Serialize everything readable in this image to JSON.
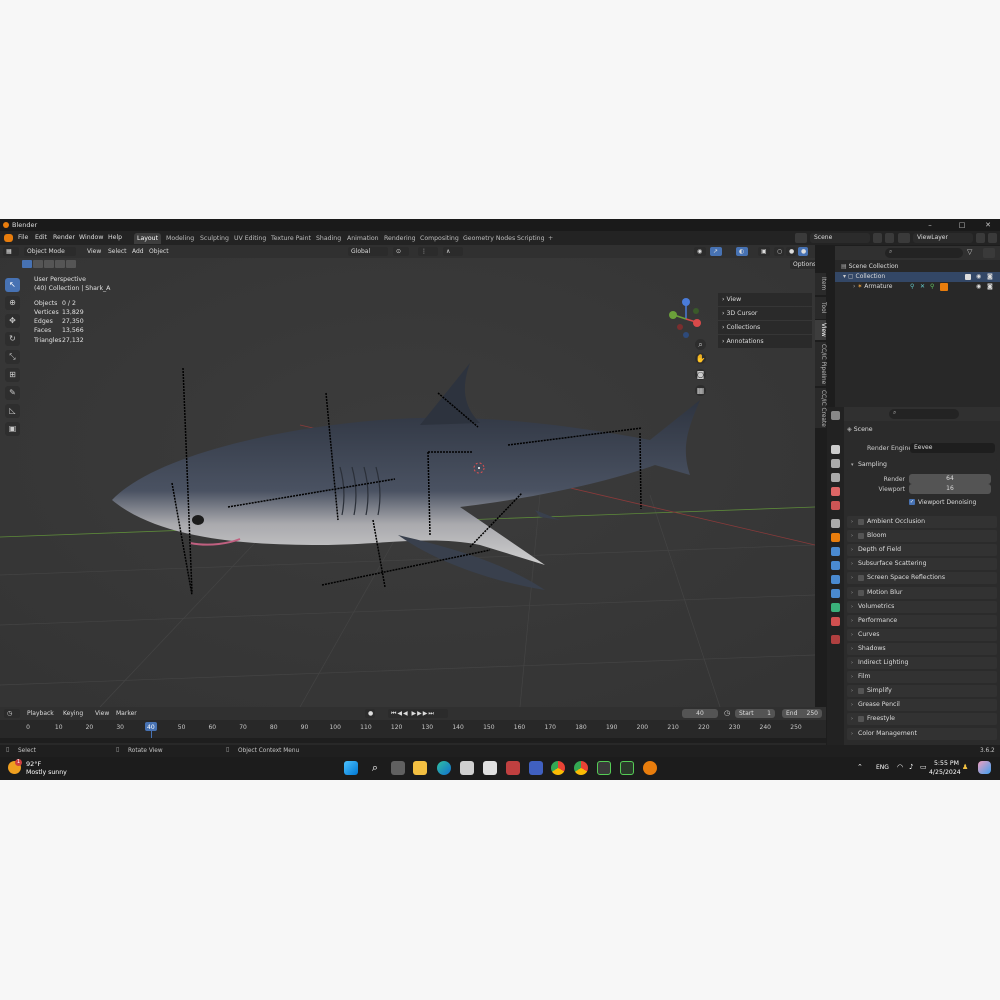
{
  "window": {
    "title": "Blender",
    "controls": [
      "–",
      "□",
      "✕"
    ]
  },
  "menu": {
    "items": [
      "File",
      "Edit",
      "Render",
      "Window",
      "Help"
    ]
  },
  "workspaces": {
    "tabs": [
      "Layout",
      "Modeling",
      "Sculpting",
      "UV Editing",
      "Texture Paint",
      "Shading",
      "Animation",
      "Rendering",
      "Compositing",
      "Geometry Nodes",
      "Scripting"
    ],
    "active": "Layout",
    "add": "+"
  },
  "scene_field": "Scene",
  "view_layer_field": "ViewLayer",
  "viewport": {
    "mode": "Object Mode",
    "header_menus": [
      "View",
      "Select",
      "Add",
      "Object"
    ],
    "orientation": "Global",
    "options": "Options",
    "info_line1": "User Perspective",
    "info_line2": "(40) Collection | Shark_A",
    "stats": [
      {
        "key": "Objects",
        "value": "0 / 2"
      },
      {
        "key": "Vertices",
        "value": "13,829"
      },
      {
        "key": "Edges",
        "value": "27,350"
      },
      {
        "key": "Faces",
        "value": "13,566"
      },
      {
        "key": "Triangles",
        "value": "27,132"
      }
    ],
    "side_items": [
      "View",
      "3D Cursor",
      "Collections",
      "Annotations"
    ],
    "side_tabs": [
      "Item",
      "Tool",
      "View",
      "CC/iC Pipeline",
      "CC/iC Create"
    ],
    "gizmo_labels": {
      "z": "Z",
      "y": "Y",
      "x": "X"
    }
  },
  "timeline": {
    "menus": [
      "Playback",
      "Keying",
      "View",
      "Marker"
    ],
    "current_frame": "40",
    "start_label": "Start",
    "start": "1",
    "end_label": "End",
    "end": "250",
    "ticks": [
      "0",
      "10",
      "20",
      "30",
      "40",
      "50",
      "60",
      "70",
      "80",
      "90",
      "100",
      "110",
      "120",
      "130",
      "140",
      "150",
      "160",
      "170",
      "180",
      "190",
      "200",
      "210",
      "220",
      "230",
      "240",
      "250"
    ],
    "playhead": 40
  },
  "statusbar": {
    "select": "Select",
    "rotate": "Rotate View",
    "context": "Object Context Menu",
    "version": "3.6.2"
  },
  "outliner": {
    "rows": [
      {
        "label": "Scene Collection",
        "indent": 0
      },
      {
        "label": "Collection",
        "indent": 1
      },
      {
        "label": "Armature",
        "indent": 2
      }
    ]
  },
  "properties": {
    "scene_label": "Scene",
    "render_engine_label": "Render Engine",
    "render_engine_value": "Eevee",
    "sampling": "Sampling",
    "render_label": "Render",
    "render_value": "64",
    "viewport_label": "Viewport",
    "viewport_value": "16",
    "denoise_label": "Viewport Denoising",
    "panels": [
      {
        "label": "Ambient Occlusion",
        "checkbox": true
      },
      {
        "label": "Bloom",
        "checkbox": true
      },
      {
        "label": "Depth of Field",
        "checkbox": false
      },
      {
        "label": "Subsurface Scattering",
        "checkbox": false
      },
      {
        "label": "Screen Space Reflections",
        "checkbox": true
      },
      {
        "label": "Motion Blur",
        "checkbox": true
      },
      {
        "label": "Volumetrics",
        "checkbox": false
      },
      {
        "label": "Performance",
        "checkbox": false
      },
      {
        "label": "Curves",
        "checkbox": false
      },
      {
        "label": "Shadows",
        "checkbox": false
      },
      {
        "label": "Indirect Lighting",
        "checkbox": false
      },
      {
        "label": "Film",
        "checkbox": false
      },
      {
        "label": "Simplify",
        "checkbox": true
      },
      {
        "label": "Grease Pencil",
        "checkbox": false
      },
      {
        "label": "Freestyle",
        "checkbox": true
      },
      {
        "label": "Color Management",
        "checkbox": false
      }
    ]
  },
  "taskbar": {
    "weather_temp": "92°F",
    "weather_desc": "Mostly sunny",
    "weather_badge": "1",
    "lang": "ENG",
    "time": "5:55 PM",
    "date": "4/25/2024"
  },
  "colors": {
    "accent": "#4772b3",
    "orange": "#e87d0d",
    "viewport_bg": "#3a3a3a",
    "shark_body": "#3b4250"
  }
}
